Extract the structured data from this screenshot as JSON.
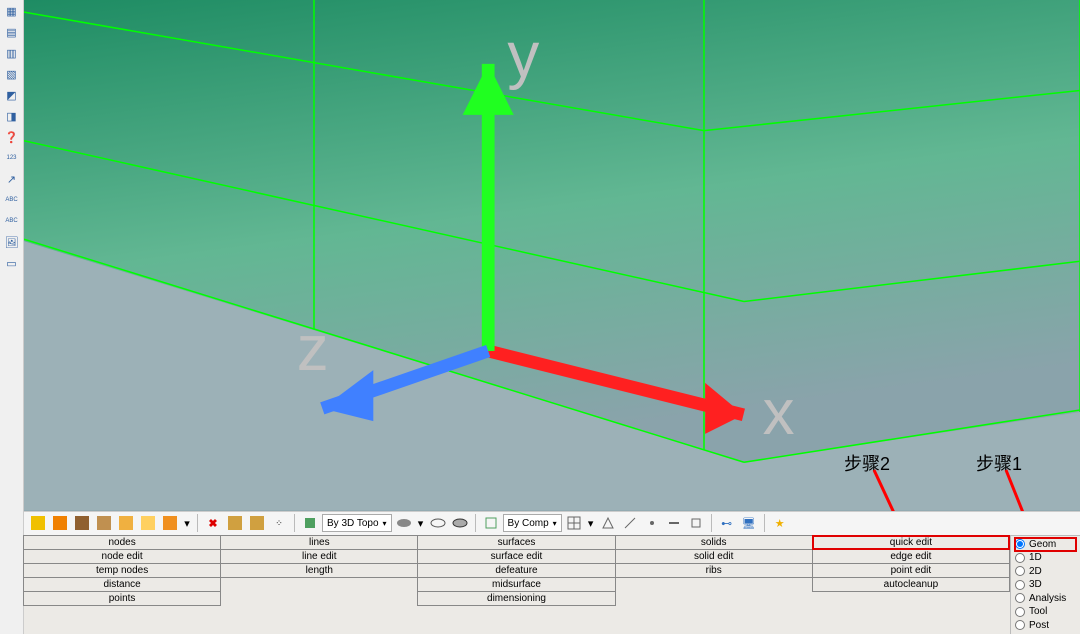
{
  "left_toolbar": [
    {
      "name": "assembly-icon",
      "glyph": "▦"
    },
    {
      "name": "components-icon",
      "glyph": "▤"
    },
    {
      "name": "model-icon",
      "glyph": "▥"
    },
    {
      "name": "card-icon",
      "glyph": "▧"
    },
    {
      "name": "isometric-icon",
      "glyph": "◩"
    },
    {
      "name": "orient-icon",
      "glyph": "◨"
    },
    {
      "name": "help-icon",
      "glyph": "❓"
    },
    {
      "name": "numbers-icon",
      "glyph": "123"
    },
    {
      "name": "vector-icon",
      "glyph": "↗"
    },
    {
      "name": "abc-tag-icon",
      "glyph": "ABC"
    },
    {
      "name": "abc-down-icon",
      "glyph": "ABC"
    },
    {
      "name": "image-icon",
      "glyph": "🖼"
    },
    {
      "name": "window-icon",
      "glyph": "▭"
    }
  ],
  "viewport": {
    "axis_labels": {
      "x": "x",
      "y": "y",
      "z": "z"
    }
  },
  "annotations": {
    "step1": "步骤1",
    "step2": "步骤2"
  },
  "toolbar_mid": {
    "combo1_label": "By 3D Topo",
    "combo2_label": "By Comp"
  },
  "panel": {
    "grid": [
      [
        "nodes",
        "lines",
        "surfaces",
        "solids",
        "quick edit"
      ],
      [
        "node edit",
        "line edit",
        "surface edit",
        "solid edit",
        "edge edit"
      ],
      [
        "temp nodes",
        "length",
        "defeature",
        "ribs",
        "point edit"
      ],
      [
        "distance",
        "",
        "midsurface",
        "",
        "autocleanup"
      ],
      [
        "points",
        "",
        "dimensioning",
        "",
        ""
      ]
    ],
    "highlight_cell": [
      0,
      4
    ]
  },
  "radio_menu": {
    "items": [
      "Geom",
      "1D",
      "2D",
      "3D",
      "Analysis",
      "Tool",
      "Post"
    ],
    "selected": 0,
    "highlight": 0
  }
}
